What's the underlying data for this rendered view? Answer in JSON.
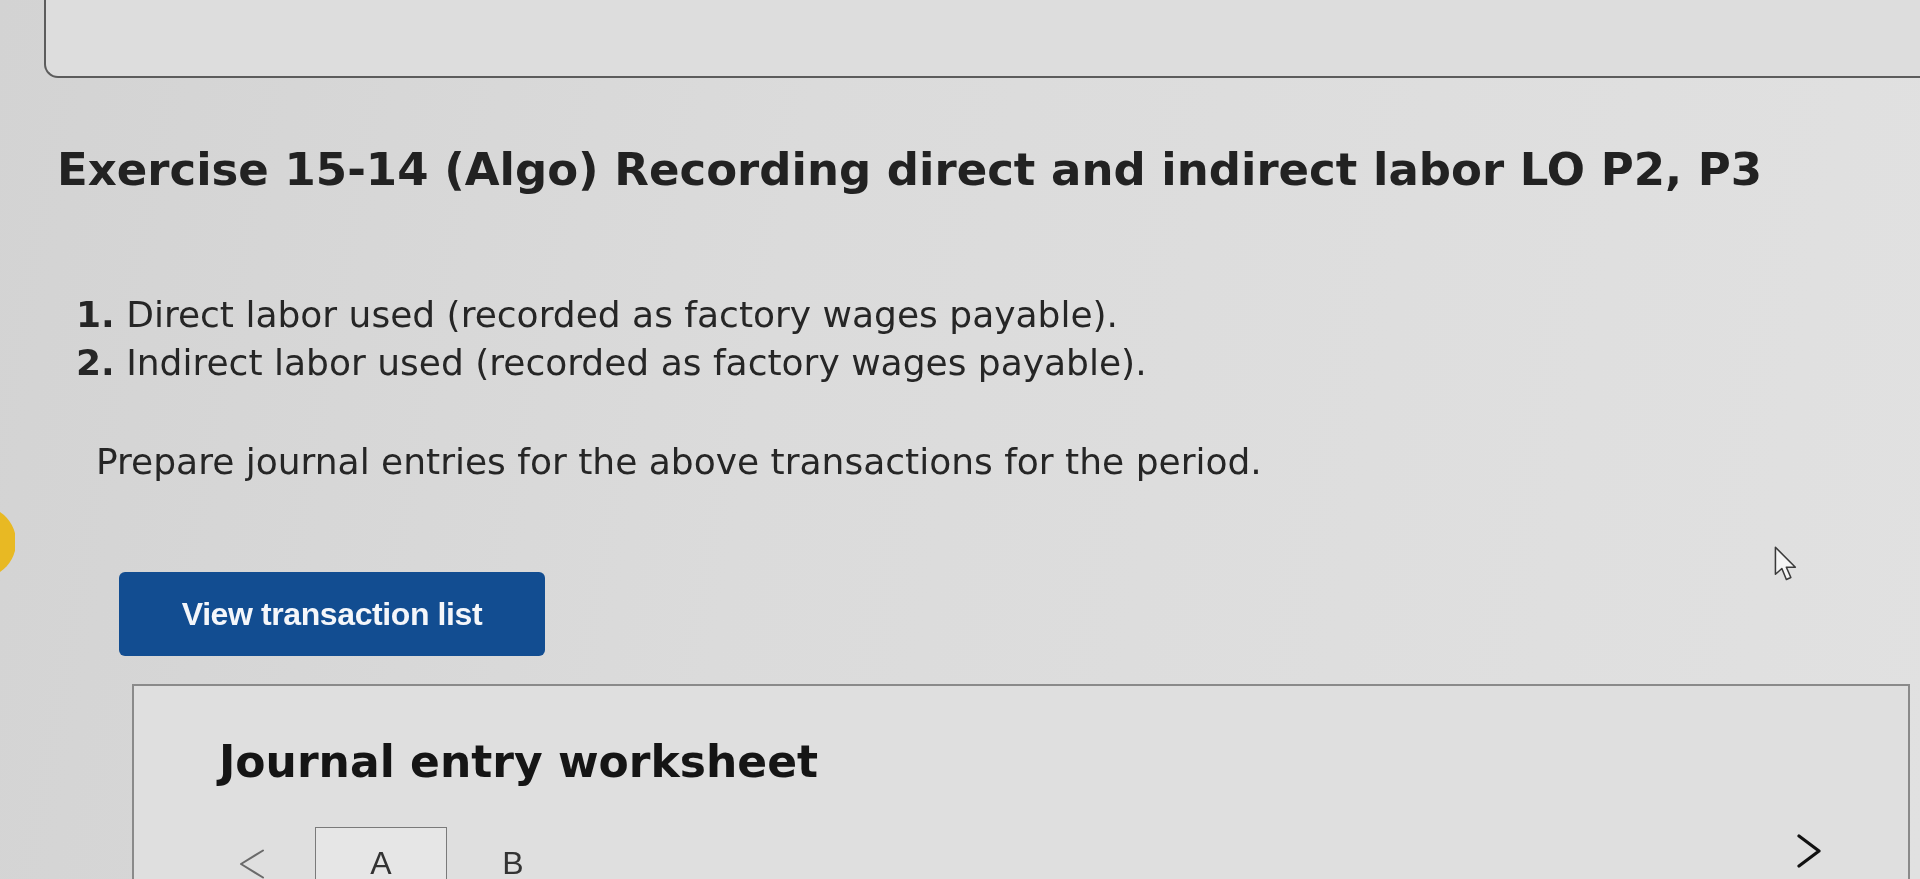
{
  "exercise": {
    "title": "Exercise 15-14 (Algo) Recording direct and indirect labor LO P2, P3",
    "items": [
      "**1.** Direct labor used (recorded as factory wages payable).",
      "**2.** Indirect labor used (recorded as factory wages payable)."
    ],
    "instruction": "Prepare journal entries for the above transactions for the period."
  },
  "view_button": {
    "label": "View transaction list"
  },
  "worksheet": {
    "title": "Journal entry worksheet",
    "prev_button": {
      "disabled": true
    },
    "tabs": [
      {
        "label": "A",
        "selected": true
      },
      {
        "label": "B",
        "selected": false
      }
    ],
    "next_button": {
      "disabled": false
    }
  }
}
